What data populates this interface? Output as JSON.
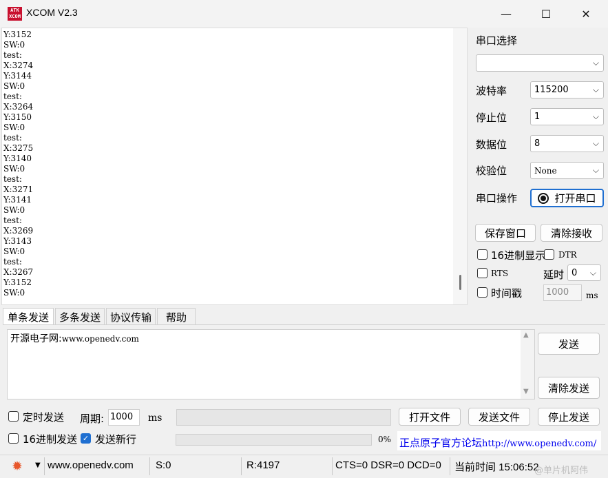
{
  "window": {
    "title": "XCOM V2.3",
    "logo_text_top": "ATK",
    "logo_text_bottom": "XCOM",
    "minimize": "—",
    "maximize": "☐",
    "close": "✕"
  },
  "receive": {
    "lines": [
      "Y:3152",
      "SW:0",
      "test:",
      "X:3274",
      "Y:3144",
      "SW:0",
      "test:",
      "X:3264",
      "Y:3150",
      "SW:0",
      "test:",
      "X:3275",
      "Y:3140",
      "SW:0",
      "test:",
      "X:3271",
      "Y:3141",
      "SW:0",
      "test:",
      "X:3269",
      "Y:3143",
      "SW:0",
      "test:",
      "X:3267",
      "Y:3152",
      "SW:0"
    ]
  },
  "serial": {
    "select_label": "串口选择",
    "port_value": "",
    "baud_label": "波特率",
    "baud_value": "115200",
    "stop_label": "停止位",
    "stop_value": "1",
    "data_label": "数据位",
    "data_value": "8",
    "parity_label": "校验位",
    "parity_value": "None",
    "op_label": "串口操作",
    "open_button": "打开串口",
    "save_button": "保存窗口",
    "clear_recv_button": "清除接收",
    "hex_display": "16进制显示",
    "dtr": "DTR",
    "rts": "RTS",
    "delay_label": "延时",
    "delay_value": "0",
    "timestamp": "时间戳",
    "timestamp_value": "1000",
    "ms": "ms"
  },
  "tabs": [
    "单条发送",
    "多条发送",
    "协议传输",
    "帮助"
  ],
  "send": {
    "text_prefix": "开源电子网:",
    "text_url": "www.openedv.com",
    "send_button": "发送",
    "clear_send_button": "清除发送",
    "timed_send": "定时发送",
    "period_label": "周期:",
    "period_value": "1000",
    "ms": "ms",
    "open_file_button": "打开文件",
    "send_file_button": "发送文件",
    "stop_send_button": "停止发送",
    "hex_send": "16进制发送",
    "send_newline": "发送新行",
    "progress": "0%",
    "forum_label": "正点原子官方论坛",
    "forum_url": "http://www.openedv.com/"
  },
  "status": {
    "site": "www.openedv.com",
    "sent": "S:0",
    "received": "R:4197",
    "lines": "CTS=0 DSR=0 DCD=0",
    "time": "当前时间 15:06:52"
  },
  "watermark": "@单片机阿伟",
  "colors": {
    "accent": "#1f6fd1",
    "link": "#0000ee",
    "logo": "#c8102e",
    "gear": "#e8562a"
  }
}
